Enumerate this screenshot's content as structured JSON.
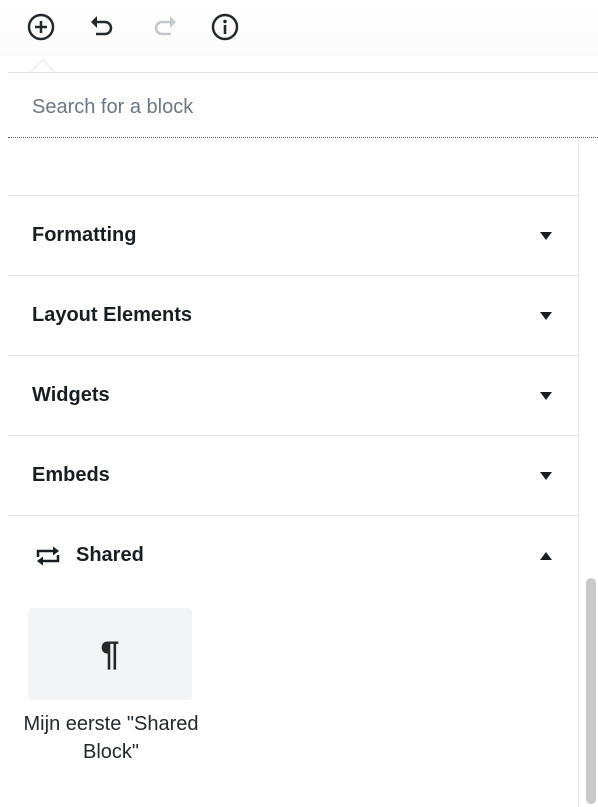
{
  "toolbar": {
    "buttons": [
      {
        "name": "add-block-button",
        "icon": "plus-circle-icon"
      },
      {
        "name": "undo-button",
        "icon": "undo-icon"
      },
      {
        "name": "redo-button",
        "icon": "redo-icon"
      },
      {
        "name": "info-button",
        "icon": "info-icon"
      }
    ]
  },
  "inserter": {
    "search_placeholder": "Search for a block",
    "categories": [
      {
        "label": "Formatting",
        "expanded": false
      },
      {
        "label": "Layout Elements",
        "expanded": false
      },
      {
        "label": "Widgets",
        "expanded": false
      },
      {
        "label": "Embeds",
        "expanded": false
      },
      {
        "label": "Shared",
        "expanded": true,
        "icon": "shared-loop-icon"
      }
    ],
    "shared_blocks": [
      {
        "label": "Mijn eerste \"Shared Block\"",
        "icon": "paragraph-icon",
        "glyph": "¶"
      }
    ]
  },
  "colors": {
    "text": "#191e23",
    "muted": "#6c7781",
    "divider": "#e2e4e7",
    "tile_bg": "#f3f4f5"
  }
}
